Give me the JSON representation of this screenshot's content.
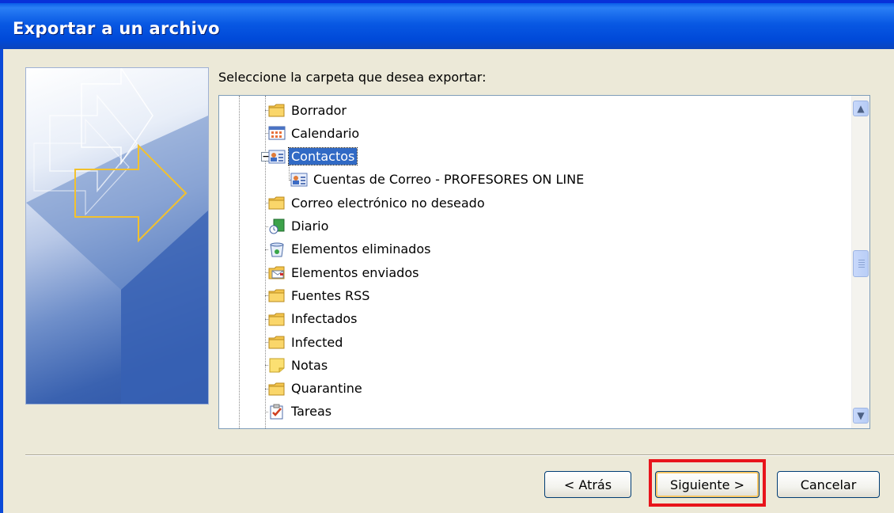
{
  "window": {
    "title": "Exportar a un archivo"
  },
  "prompt": "Seleccione la carpeta que desea exportar:",
  "tree": {
    "items": [
      {
        "label": "Borrador",
        "icon": "folder-icon"
      },
      {
        "label": "Calendario",
        "icon": "calendar-icon"
      },
      {
        "label": "Contactos",
        "icon": "contacts-icon",
        "selected": true,
        "expanded": true
      },
      {
        "label": "Cuentas de Correo - PROFESORES ON LINE",
        "icon": "contacts-icon"
      },
      {
        "label": "Correo electrónico no deseado",
        "icon": "folder-icon"
      },
      {
        "label": "Diario",
        "icon": "journal-icon"
      },
      {
        "label": "Elementos eliminados",
        "icon": "deleted-items-icon"
      },
      {
        "label": "Elementos enviados",
        "icon": "sent-items-icon"
      },
      {
        "label": "Fuentes RSS",
        "icon": "folder-icon"
      },
      {
        "label": "Infectados",
        "icon": "folder-icon"
      },
      {
        "label": "Infected",
        "icon": "folder-icon"
      },
      {
        "label": "Notas",
        "icon": "notes-icon"
      },
      {
        "label": "Quarantine",
        "icon": "folder-icon"
      },
      {
        "label": "Tareas",
        "icon": "tasks-icon"
      }
    ],
    "expander_minus": "−"
  },
  "scrollbar": {
    "up": "▲",
    "down": "▼"
  },
  "buttons": {
    "back": "< Atrás",
    "next": "Siguiente >",
    "cancel": "Cancelar"
  },
  "colors": {
    "titlebar": "#0858e3",
    "selection": "#316ac5",
    "highlight_box": "#e8141b",
    "dialog_bg": "#ece9d8"
  }
}
